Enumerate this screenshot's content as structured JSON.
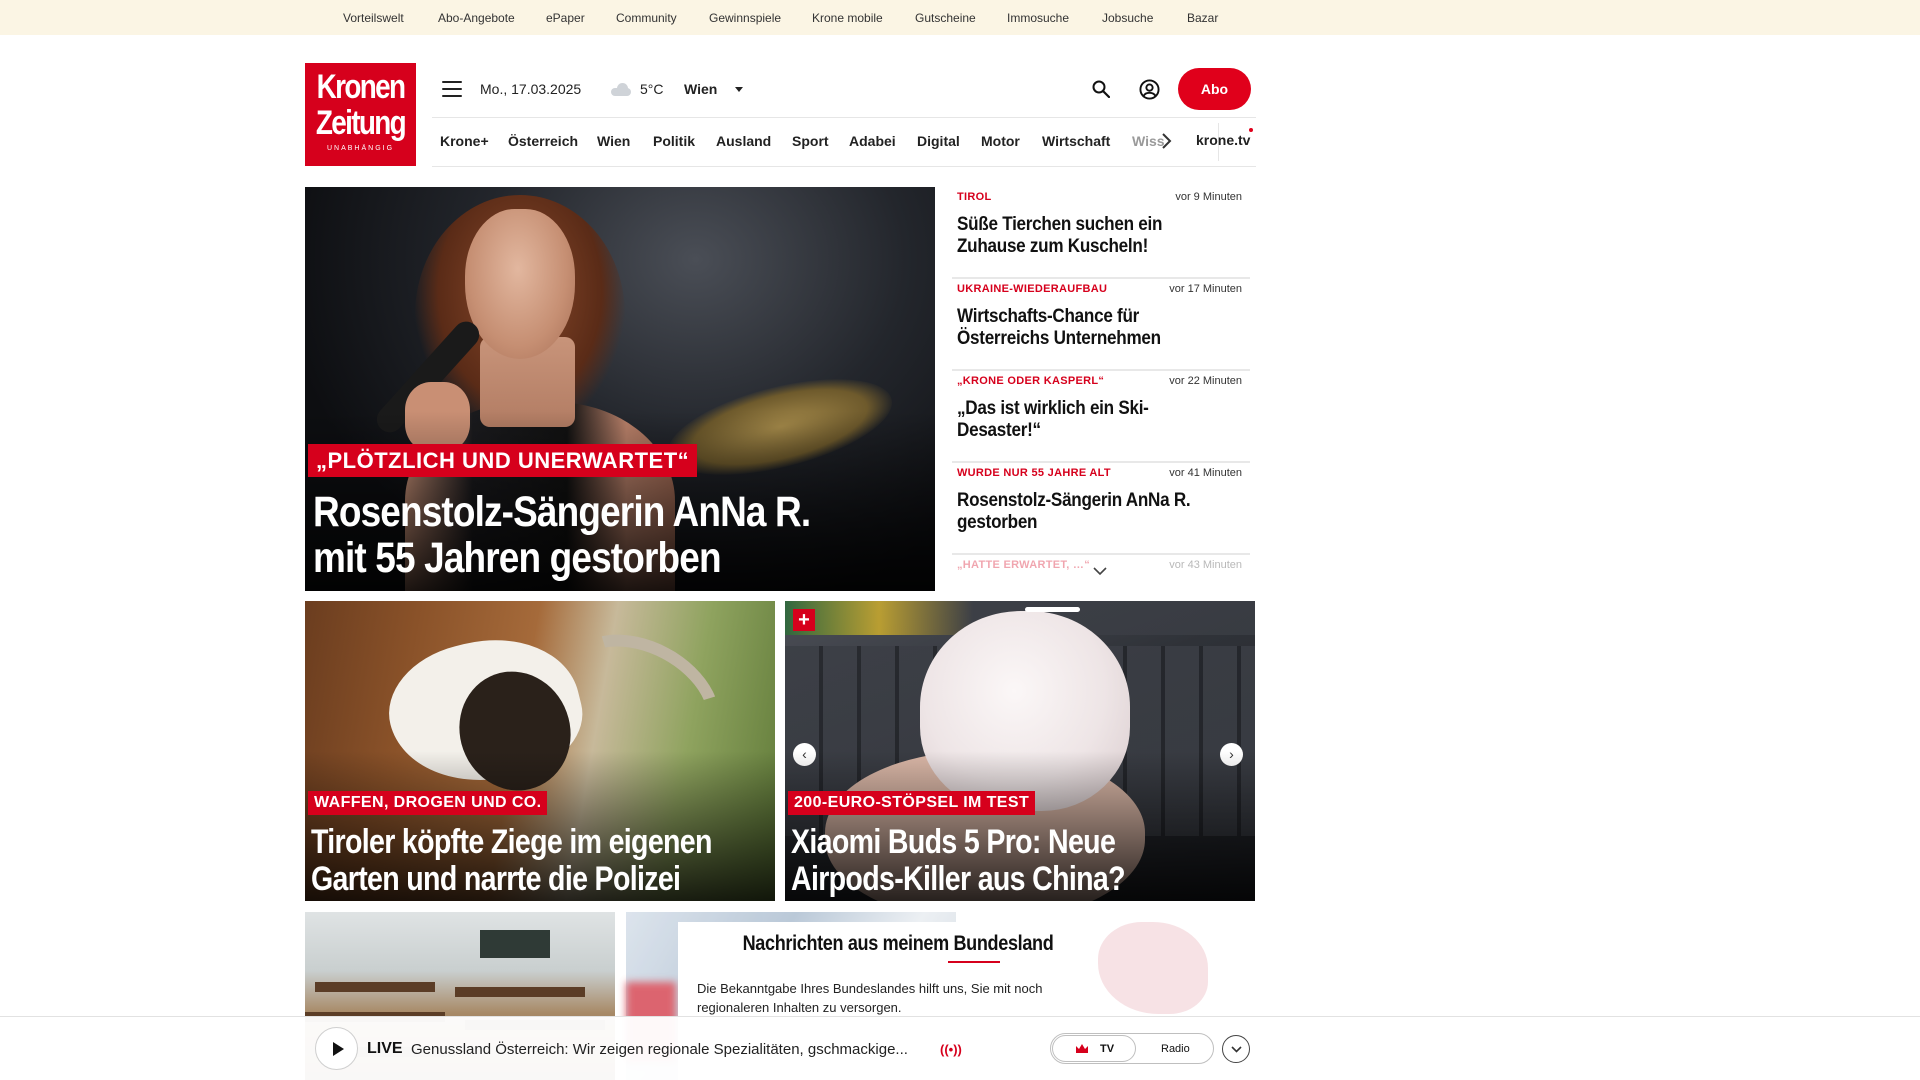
{
  "topbar": {
    "links": [
      "Vorteilswelt",
      "Abo-Angebote",
      "ePaper",
      "Community",
      "Gewinnspiele",
      "Krone mobile",
      "Gutscheine",
      "Immosuche",
      "Jobsuche",
      "Bazar"
    ]
  },
  "header": {
    "logo_line1": "Kronen",
    "logo_line2": "Zeitung",
    "logo_tagline": "UNABHÄNGIG",
    "date": "Mo., 17.03.2025",
    "temperature": "5°C",
    "city": "Wien",
    "abo_label": "Abo",
    "icons": {
      "menu": "menu-icon",
      "weather": "cloud-icon",
      "search": "search-icon",
      "account": "user-icon"
    }
  },
  "nav": {
    "items": [
      "Krone+",
      "Österreich",
      "Wien",
      "Politik",
      "Ausland",
      "Sport",
      "Adabei",
      "Digital",
      "Motor",
      "Wirtschaft",
      "Wiss"
    ],
    "krone_tv": "krone.tv"
  },
  "hero": {
    "kicker": "„PLÖTZLICH UND UNERWARTET“",
    "title_line1": "Rosenstolz-Sängerin AnNa R.",
    "title_line2": "mit 55 Jahren gestorben"
  },
  "ticker": [
    {
      "category": "TIROL",
      "time": "vor 9 Minuten",
      "headline": "Süße Tierchen suchen ein Zuhause zum Kuscheln!"
    },
    {
      "category": "UKRAINE-WIEDERAUFBAU",
      "time": "vor 17 Minuten",
      "headline": "Wirtschafts-Chance für Österreichs Unternehmen"
    },
    {
      "category": "„KRONE ODER KASPERL“",
      "time": "vor 22 Minuten",
      "headline": "„Das ist wirklich ein Ski-Desaster!“"
    },
    {
      "category": "WURDE NUR 55 JAHRE ALT",
      "time": "vor 41 Minuten",
      "headline": "Rosenstolz-Sängerin AnNa R. gestorben"
    },
    {
      "category": "„HATTE ERWARTET, …“",
      "time": "vor 43 Minuten",
      "headline": ""
    }
  ],
  "teasers": [
    {
      "kicker": "WAFFEN, DROGEN UND CO.",
      "title_line1": "Tiroler köpfte Ziege im eigenen",
      "title_line2": "Garten und narrte die Polizei"
    },
    {
      "kicker": "200-EURO-STÖPSEL IM TEST",
      "title_line1": "Xiaomi Buds 5 Pro: Neue",
      "title_line2": "Airpods-Killer aus China?"
    }
  ],
  "bundesland": {
    "title": "Nachrichten aus meinem Bundesland",
    "text": "Die Bekanntgabe Ihres Bundeslandes hilft uns, Sie mit noch regionaleren Inhalten zu versorgen."
  },
  "live": {
    "label": "LIVE",
    "text": "Genussland Österreich: Wir zeigen regionale Spezialitäten, gschmackige...",
    "signal": "((•))",
    "tv_label": "TV",
    "radio_label": "Radio"
  },
  "colors": {
    "brand_red": "#d6001c",
    "topbar_bg": "#fbf5e4"
  }
}
